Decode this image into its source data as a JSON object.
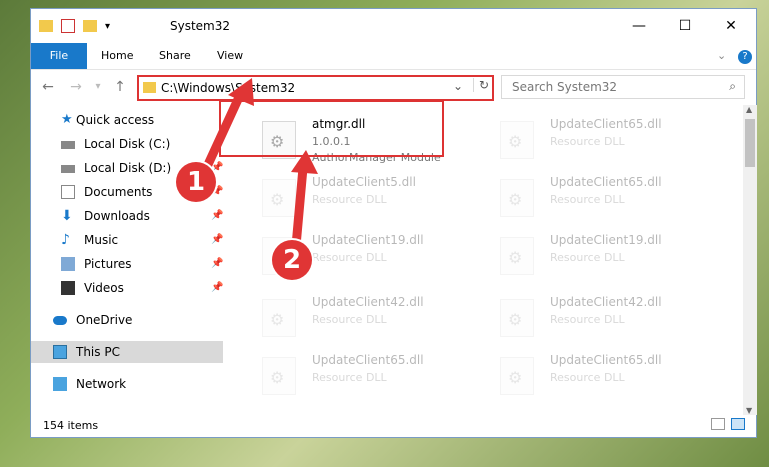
{
  "window": {
    "title": "System32",
    "controls": {
      "minimize": "—",
      "maximize": "☐",
      "close": "✕"
    }
  },
  "ribbon": {
    "tabs": [
      "File",
      "Home",
      "Share",
      "View"
    ],
    "help": "?"
  },
  "address": {
    "path": "C:\\Windows\\System32",
    "dropdown": "⌄",
    "refresh": "↻"
  },
  "search": {
    "placeholder": "Search System32",
    "icon": "search-icon"
  },
  "sidebar": {
    "items": [
      {
        "label": "Quick access",
        "icon": "star-icon",
        "pinned": false
      },
      {
        "label": "Local Disk (C:)",
        "icon": "drive-icon",
        "pinned": false
      },
      {
        "label": "Local Disk (D:)",
        "icon": "drive-icon",
        "pinned": true
      },
      {
        "label": "Documents",
        "icon": "document-icon",
        "pinned": true
      },
      {
        "label": "Downloads",
        "icon": "download-icon",
        "pinned": true
      },
      {
        "label": "Music",
        "icon": "music-icon",
        "pinned": true
      },
      {
        "label": "Pictures",
        "icon": "pictures-icon",
        "pinned": true
      },
      {
        "label": "Videos",
        "icon": "videos-icon",
        "pinned": true
      },
      {
        "label": "OneDrive",
        "icon": "cloud-icon",
        "pinned": false
      },
      {
        "label": "This PC",
        "icon": "pc-icon",
        "pinned": false,
        "selected": true
      },
      {
        "label": "Network",
        "icon": "network-icon",
        "pinned": false
      }
    ]
  },
  "files": {
    "left": [
      {
        "name": "atmgr.dll",
        "line1": "1.0.0.1",
        "line2": "AuthorManager Module",
        "highlight": true
      },
      {
        "name": "UpdateClient5.dll",
        "line1": "Resource DLL"
      },
      {
        "name": "UpdateClient19.dll",
        "line1": "Resource DLL"
      },
      {
        "name": "UpdateClient42.dll",
        "line1": "Resource DLL"
      },
      {
        "name": "UpdateClient65.dll",
        "line1": "Resource DLL"
      }
    ],
    "right": [
      {
        "name": "UpdateClient65.dll",
        "line1": "Resource DLL"
      },
      {
        "name": "UpdateClient65.dll",
        "line1": "Resource DLL"
      },
      {
        "name": "UpdateClient19.dll",
        "line1": "Resource DLL"
      },
      {
        "name": "UpdateClient42.dll",
        "line1": "Resource DLL"
      },
      {
        "name": "UpdateClient65.dll",
        "line1": "Resource DLL"
      }
    ]
  },
  "status": {
    "count": "154 items"
  },
  "callouts": [
    "1",
    "2"
  ],
  "colors": {
    "accent": "#1979ca",
    "highlight": "#dd3333"
  }
}
